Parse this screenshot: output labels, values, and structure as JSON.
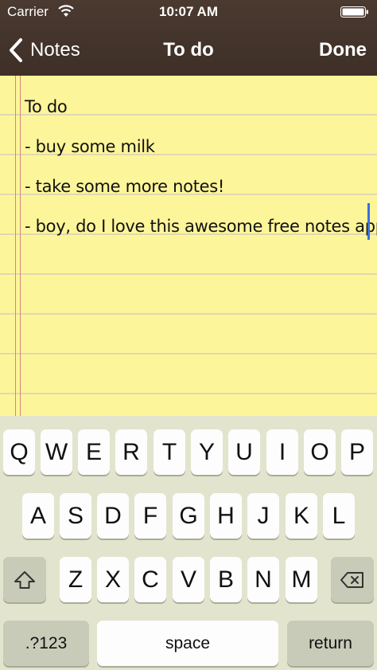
{
  "status_bar": {
    "carrier": "Carrier",
    "time": "10:07 AM",
    "wifi_icon": "wifi-icon",
    "battery_icon": "battery-icon"
  },
  "nav": {
    "back_label": "Notes",
    "title": "To do",
    "done_label": "Done",
    "back_icon": "chevron-left-icon"
  },
  "note": {
    "lines": [
      "To do",
      "- buy some milk",
      "- take some more notes!",
      "- boy, do I love this awesome free notes app!"
    ]
  },
  "keyboard": {
    "row1": [
      "Q",
      "W",
      "E",
      "R",
      "T",
      "Y",
      "U",
      "I",
      "O",
      "P"
    ],
    "row2": [
      "A",
      "S",
      "D",
      "F",
      "G",
      "H",
      "J",
      "K",
      "L"
    ],
    "row3": [
      "Z",
      "X",
      "C",
      "V",
      "B",
      "N",
      "M"
    ],
    "shift_icon": "shift-icon",
    "backspace_icon": "backspace-icon",
    "numbers_label": ".?123",
    "space_label": "space",
    "return_label": "return"
  },
  "colors": {
    "header_bg": "#3e2f27",
    "paper_bg": "#fdf59a",
    "margin_line": "#d4857c",
    "caret": "#3a6fdc",
    "keyboard_bg": "#e2e4cd"
  }
}
